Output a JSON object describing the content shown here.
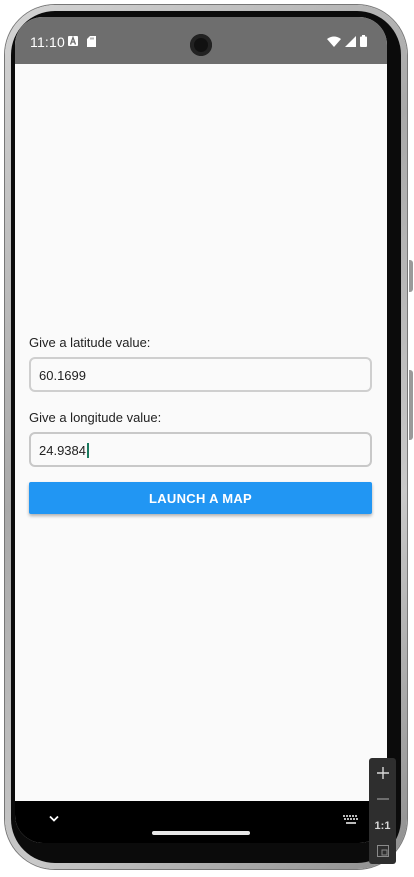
{
  "status_bar": {
    "time": "11:10",
    "left_icons": [
      "a-notification-icon",
      "sd-card-icon"
    ],
    "right_icons": [
      "wifi-icon",
      "signal-icon",
      "battery-icon"
    ]
  },
  "form": {
    "latitude_label": "Give a latitude value:",
    "latitude_value": "60.1699",
    "longitude_label": "Give a longitude value:",
    "longitude_value": "24.9384",
    "launch_button": "LAUNCH A MAP"
  },
  "navigation_bar": {
    "icons": [
      "chevron-down-icon",
      "home-pill",
      "keyboard-icon"
    ]
  },
  "emulator_controls": {
    "zoom_ratio": "1:1",
    "icons": [
      "zoom-in-icon",
      "zoom-out-icon",
      "fit-screen-icon"
    ]
  },
  "colors": {
    "accent": "#2196f3",
    "status_bar": "#6e6e6e",
    "cursor": "#1a7a5e"
  }
}
